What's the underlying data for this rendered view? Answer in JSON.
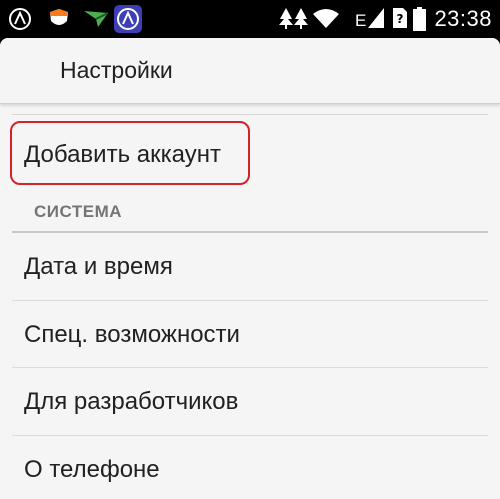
{
  "status_bar": {
    "time": "23:38",
    "network_type": "E",
    "icons": [
      "avast-icon",
      "shield-icon",
      "arrow-icon",
      "adguard-icon",
      "tree-icon",
      "tree-icon",
      "wifi-icon",
      "signal-icon",
      "sim-question-icon",
      "battery-icon"
    ]
  },
  "action_bar": {
    "title": "Настройки"
  },
  "list": {
    "add_account": "Добавить аккаунт",
    "section_header": "СИСТЕМА",
    "items": [
      {
        "label": "Дата и время"
      },
      {
        "label": "Спец. возможности"
      },
      {
        "label": "Для разработчиков"
      },
      {
        "label": "О телефоне"
      }
    ]
  },
  "colors": {
    "highlight": "#d2232a",
    "background": "#f5f5f5",
    "status_bar": "#000000"
  }
}
